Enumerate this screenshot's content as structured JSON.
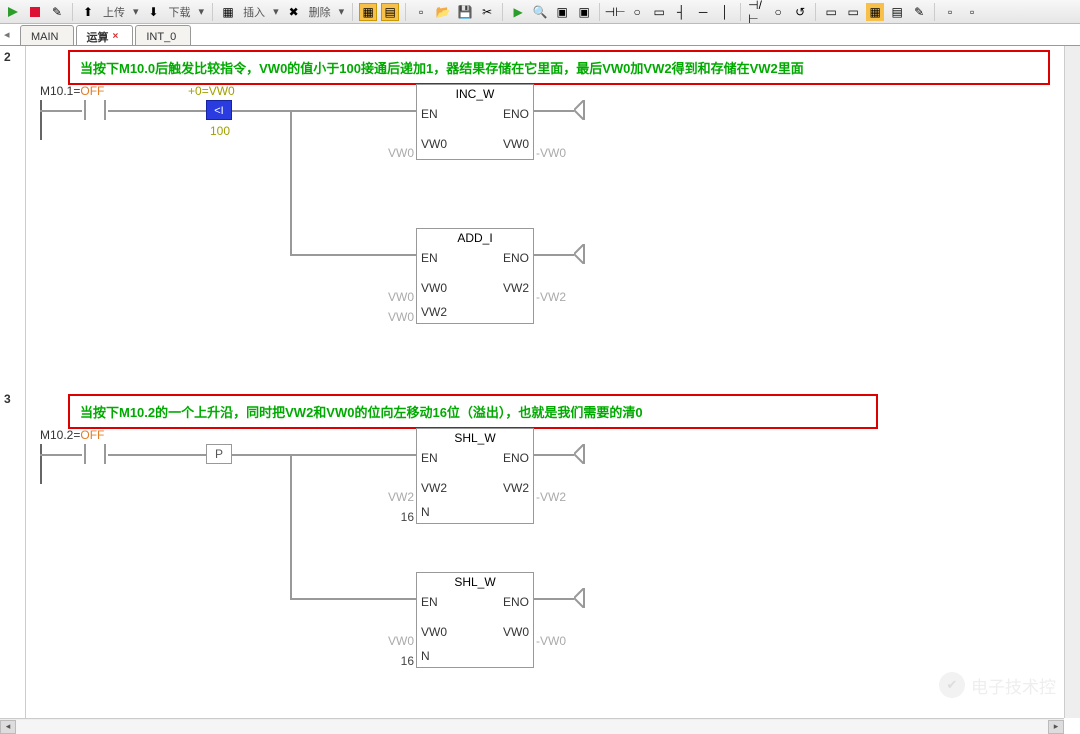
{
  "toolbar": {
    "upload": "上传",
    "download": "下载",
    "insert": "插入",
    "delete": "删除"
  },
  "tabs": {
    "items": [
      {
        "label": "MAIN",
        "active": false
      },
      {
        "label": "运算",
        "active": true
      },
      {
        "label": "INT_0",
        "active": false
      }
    ]
  },
  "network2": {
    "num": "2",
    "comment": "当按下M10.0后触发比较指令，VW0的值小于100接通后递加1，器结果存储在它里面，最后VW0加VW2得到和存储在VW2里面",
    "contact": {
      "addr": "M10.1",
      "state": "OFF"
    },
    "compare": {
      "top": "+0",
      "topvar": "VW0",
      "op": "<I",
      "bot": "100"
    },
    "inc": {
      "title": "INC_W",
      "en": "EN",
      "eno": "ENO",
      "in": "VW0",
      "in_lbl": "VW0",
      "out": "VW0",
      "out_ext": "VW0"
    },
    "add": {
      "title": "ADD_I",
      "en": "EN",
      "eno": "ENO",
      "in1": "VW0",
      "in1_lbl": "VW0",
      "in2": "VW0",
      "in2_lbl": "VW2",
      "out": "VW2",
      "out_ext": "VW2"
    }
  },
  "network3": {
    "num": "3",
    "comment": "当按下M10.2的一个上升沿，同时把VW2和VW0的位向左移动16位（溢出），也就是我们需要的清0",
    "contact": {
      "addr": "M10.2",
      "state": "OFF"
    },
    "pulse": "P",
    "shl1": {
      "title": "SHL_W",
      "en": "EN",
      "eno": "ENO",
      "in": "VW2",
      "in_lbl": "VW2",
      "n": "16",
      "n_lbl": "N",
      "out": "VW2",
      "out_ext": "VW2"
    },
    "shl2": {
      "title": "SHL_W",
      "en": "EN",
      "eno": "ENO",
      "in": "VW0",
      "in_lbl": "VW0",
      "n": "16",
      "n_lbl": "N",
      "out": "VW0",
      "out_ext": "VW0"
    }
  },
  "watermark": "电子技术控"
}
